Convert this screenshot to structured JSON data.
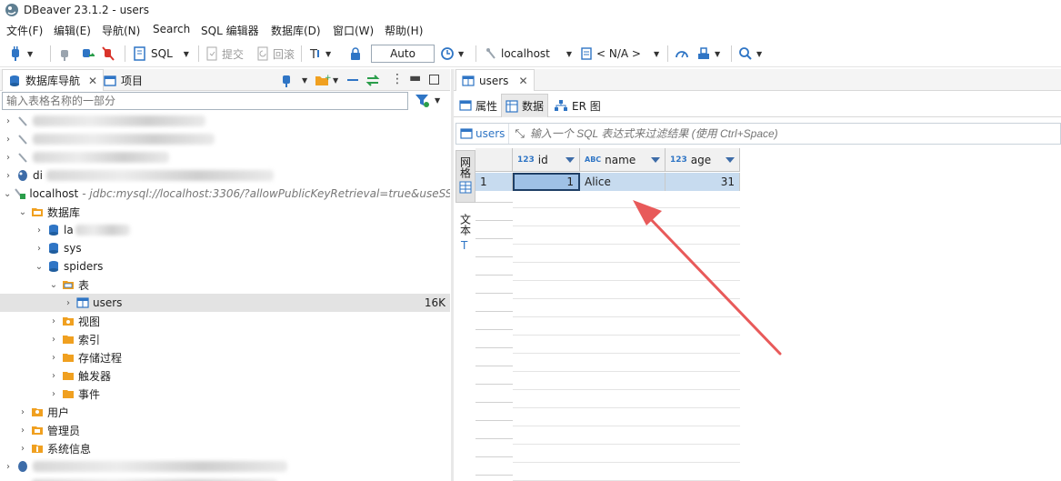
{
  "window": {
    "title": "DBeaver 23.1.2 - users"
  },
  "menu": [
    "文件(F)",
    "编辑(E)",
    "导航(N)",
    "Search",
    "SQL 编辑器",
    "数据库(D)",
    "窗口(W)",
    "帮助(H)"
  ],
  "toolbar": {
    "sql_label": "SQL",
    "commit_label": "提交",
    "rollback_label": "回滚",
    "tx_mode": "Auto",
    "datasource": "localhost",
    "schema": "< N/A >"
  },
  "left_panel": {
    "tab_navigator": "数据库导航",
    "tab_project": "项目",
    "filter_placeholder": "输入表格名称的一部分"
  },
  "tree": {
    "localhost_name": "localhost",
    "localhost_url": " - jdbc:mysql://localhost:3306/?allowPublicKeyRetrieval=true&useSSL",
    "databases": "数据库",
    "sys": "sys",
    "spiders": "spiders",
    "tables": "表",
    "users": "users",
    "users_size": "16K",
    "views": "视图",
    "indexes": "索引",
    "procedures": "存储过程",
    "triggers": "触发器",
    "events": "事件",
    "users_folder": "用户",
    "admins": "管理员",
    "sysinfo": "系统信息",
    "partial_la": "la",
    "partial_di": "di"
  },
  "editor": {
    "tab_title": "users",
    "subtab_props": "属性",
    "subtab_data": "数据",
    "subtab_er": "ER 图",
    "filter_table": "users",
    "filter_hint": "输入一个 SQL 表达式来过滤结果 (使用 Ctrl+Space)",
    "side_grid": "网格",
    "side_text": "文本"
  },
  "grid": {
    "columns": [
      {
        "type": "123",
        "name": "id"
      },
      {
        "type": "ABC",
        "name": "name"
      },
      {
        "type": "123",
        "name": "age"
      }
    ],
    "rows": [
      {
        "num": "1",
        "id": "1",
        "name": "Alice",
        "age": "31"
      }
    ]
  },
  "colors": {
    "accent": "#2f75c5",
    "selection": "#c7dbef",
    "annotation_arrow": "#e85a5a",
    "folder": "#f0a020"
  }
}
